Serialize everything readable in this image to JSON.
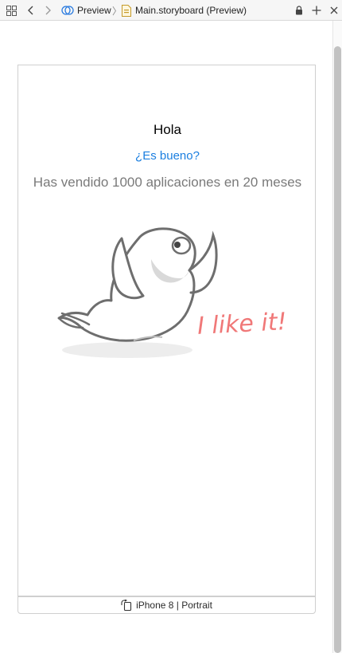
{
  "toolbar": {
    "breadcrumb": [
      {
        "label": "Preview"
      },
      {
        "label": "Main.storyboard (Preview)"
      }
    ]
  },
  "screen": {
    "greeting": "Hola",
    "question_link": "¿Es bueno?",
    "sales_text": "Has vendido 1000 aplicaciones en 20 meses",
    "illustration_caption": "I like it!"
  },
  "device": {
    "label": "iPhone 8 | Portrait"
  },
  "colors": {
    "link": "#1b7fe0",
    "caption": "#f07878",
    "subtitle": "#7a7a7a"
  },
  "icons": [
    "grid-icon",
    "back-chevron-icon",
    "forward-chevron-icon",
    "preview-icon",
    "storyboard-file-icon",
    "lock-icon",
    "add-icon",
    "close-icon",
    "rotate-device-icon"
  ]
}
